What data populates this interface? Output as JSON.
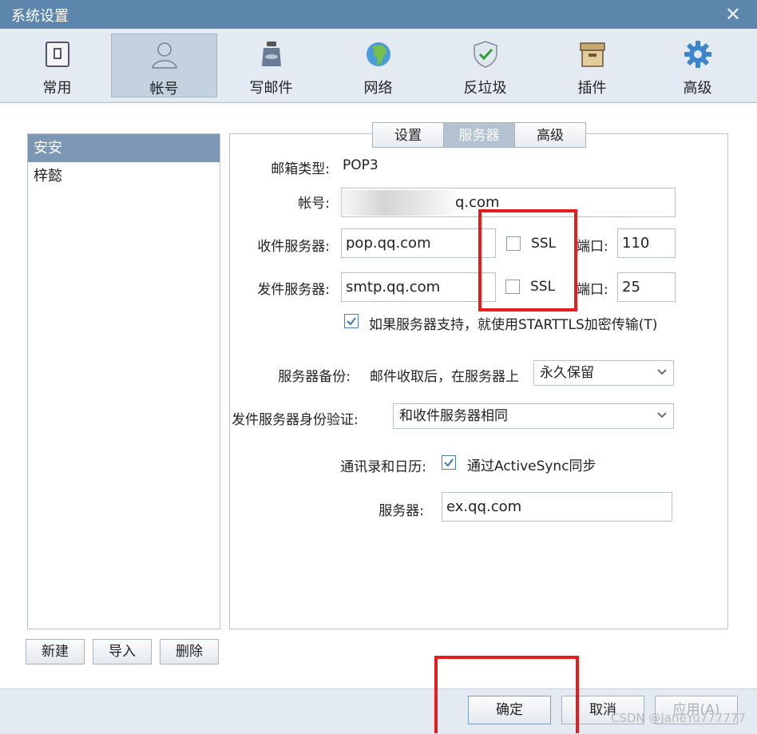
{
  "window": {
    "title": "系统设置",
    "close_glyph": "✕"
  },
  "toolbar": {
    "items": [
      {
        "label": "常用",
        "icon": "general-icon"
      },
      {
        "label": "帐号",
        "icon": "account-icon",
        "active": true
      },
      {
        "label": "写邮件",
        "icon": "compose-icon"
      },
      {
        "label": "网络",
        "icon": "network-icon"
      },
      {
        "label": "反垃圾",
        "icon": "antispam-icon"
      },
      {
        "label": "插件",
        "icon": "plugin-icon"
      },
      {
        "label": "高级",
        "icon": "advanced-icon"
      }
    ]
  },
  "accounts": {
    "items": [
      {
        "label": "安安",
        "selected": true
      },
      {
        "label": "梓懿",
        "selected": false
      }
    ],
    "new_label": "新建",
    "import_label": "导入",
    "delete_label": "删除"
  },
  "tabs": [
    {
      "label": "设置"
    },
    {
      "label": "服务器",
      "active": true
    },
    {
      "label": "高级"
    }
  ],
  "form": {
    "mailbox_type_label": "邮箱类型:",
    "mailbox_type_value": "POP3",
    "account_label": "帐号:",
    "account_value": "q.com",
    "incoming_label": "收件服务器:",
    "incoming_value": "pop.qq.com",
    "incoming_ssl_label": "SSL",
    "incoming_ssl_checked": false,
    "incoming_port_label": "端口:",
    "incoming_port_value": "110",
    "outgoing_label": "发件服务器:",
    "outgoing_value": "smtp.qq.com",
    "outgoing_ssl_label": "SSL",
    "outgoing_ssl_checked": false,
    "outgoing_port_label": "端口:",
    "outgoing_port_value": "25",
    "starttls_label": "如果服务器支持，就使用STARTTLS加密传输(T)",
    "starttls_checked": true,
    "backup_label": "服务器备份:",
    "backup_desc": "邮件收取后，在服务器上",
    "backup_value": "永久保留",
    "auth_label": "发件服务器身份验证:",
    "auth_value": "和收件服务器相同",
    "contacts_label": "通讯录和日历:",
    "activesync_label": "通过ActiveSync同步",
    "activesync_checked": true,
    "server_label": "服务器:",
    "server_value": "ex.qq.com"
  },
  "footer": {
    "ok_label": "确定",
    "cancel_label": "取消",
    "apply_label": "应用(A)"
  },
  "watermark": "CSDN @JaneYu777777",
  "colors": {
    "titlebar": "#5d86ad",
    "selection": "#7b97b3",
    "highlight": "#e81c1c",
    "checkbox": "#4a7fb5"
  }
}
